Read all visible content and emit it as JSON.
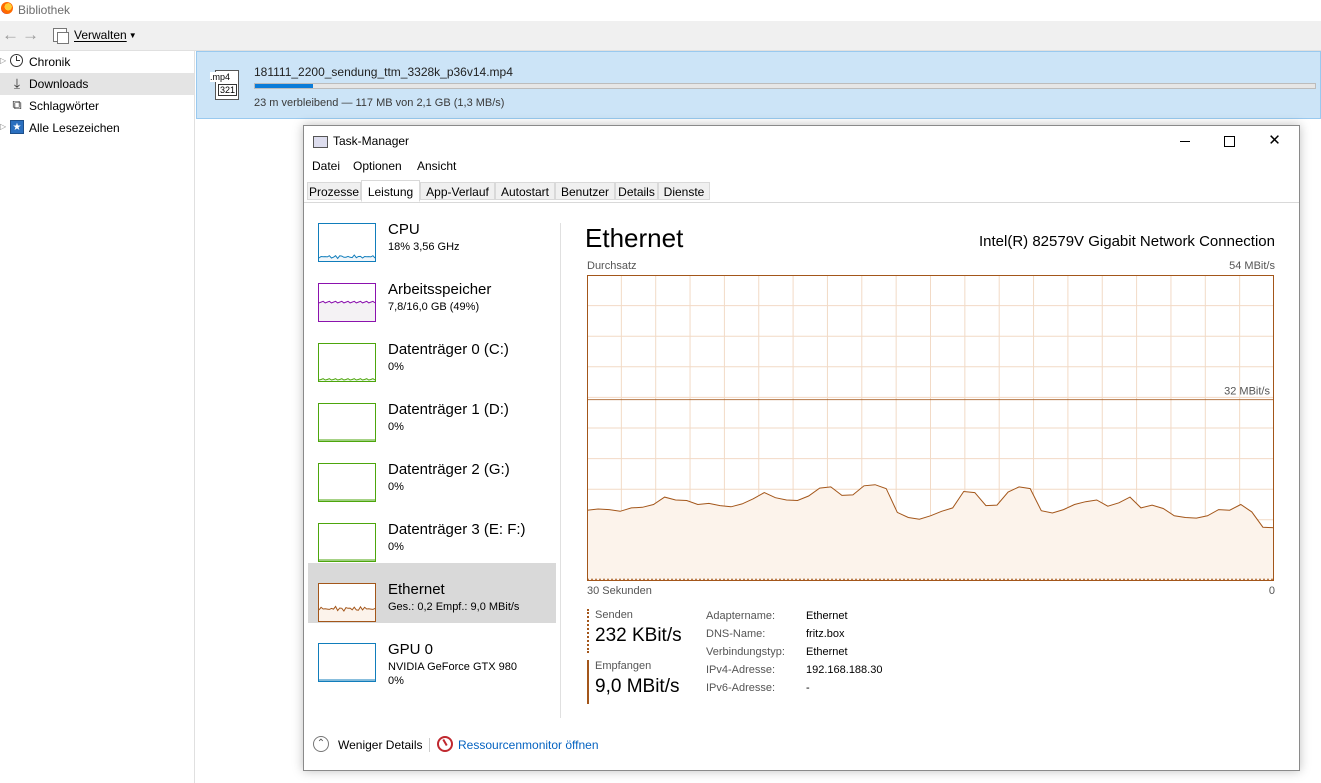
{
  "library": {
    "window_title": "Bibliothek",
    "toolbar": {
      "organize_label": "Verwalten"
    },
    "sidebar": {
      "items": [
        {
          "label": "Chronik",
          "icon": "clock-icon",
          "expandable": true
        },
        {
          "label": "Downloads",
          "icon": "download-arrow-icon",
          "selected": true
        },
        {
          "label": "Schlagwörter",
          "icon": "tag-icon"
        },
        {
          "label": "Alle Lesezeichen",
          "icon": "star-icon",
          "expandable": true
        }
      ]
    },
    "download": {
      "filename": "181111_2200_sendung_ttm_3328k_p36v14.mp4",
      "file_icon_ext": ".mp4",
      "file_icon_badge": "321",
      "status": "23 m verbleibend — 117 MB von 2,1 GB (1,3 MB/s)",
      "progress": 0.055
    }
  },
  "taskmanager": {
    "title": "Task-Manager",
    "menu": [
      "Datei",
      "Optionen",
      "Ansicht"
    ],
    "tabs": [
      "Prozesse",
      "Leistung",
      "App-Verlauf",
      "Autostart",
      "Benutzer",
      "Details",
      "Dienste"
    ],
    "active_tab": "Leistung",
    "perf_items": [
      {
        "name": "CPU",
        "sub": "18% 3,56 GHz",
        "color": "#117dbb",
        "fill": "#f1f6fa"
      },
      {
        "name": "Arbeitsspeicher",
        "sub": "7,8/16,0 GB (49%)",
        "color": "#8b12ae",
        "fill": "#f4f2f4"
      },
      {
        "name": "Datenträger 0 (C:)",
        "sub": "0%",
        "color": "#4da60c",
        "fill": "#eff7ef"
      },
      {
        "name": "Datenträger 1 (D:)",
        "sub": "0%",
        "color": "#4da60c",
        "fill": "#eff7ef"
      },
      {
        "name": "Datenträger 2 (G:)",
        "sub": "0%",
        "color": "#4da60c",
        "fill": "#eff7ef"
      },
      {
        "name": "Datenträger 3 (E: F:)",
        "sub": "0%",
        "color": "#4da60c",
        "fill": "#eff7ef"
      },
      {
        "name": "Ethernet",
        "sub": "Ges.: 0,2 Empf.: 9,0 MBit/s",
        "color": "#a3561a",
        "fill": "#fcf3eb",
        "selected": true
      },
      {
        "name": "GPU 0",
        "sub": "NVIDIA GeForce GTX 980",
        "sub2": "0%",
        "color": "#117dbb",
        "fill": "#f1f6fa"
      }
    ],
    "detail": {
      "title": "Ethernet",
      "adapter": "Intel(R) 82579V Gigabit Network Connection",
      "throughput_label": "Durchsatz",
      "max_label": "54 MBit/s",
      "mid_label": "32 MBit/s",
      "time_label": "30 Sekunden",
      "zero_label": "0",
      "send_label": "Senden",
      "send_value": "232 KBit/s",
      "recv_label": "Empfangen",
      "recv_value": "9,0 MBit/s",
      "properties": [
        {
          "key": "Adaptername:",
          "value": "Ethernet"
        },
        {
          "key": "DNS-Name:",
          "value": "fritz.box"
        },
        {
          "key": "Verbindungstyp:",
          "value": "Ethernet"
        },
        {
          "key": "IPv4-Adresse:",
          "value": "192.168.188.30"
        },
        {
          "key": "IPv6-Adresse:",
          "value": "-"
        }
      ]
    },
    "footer": {
      "fewer_details": "Weniger Details",
      "resource_monitor": "Ressourcenmonitor öffnen"
    },
    "chart_data": {
      "type": "area",
      "y_unit": "MBit/s",
      "ylim": [
        0,
        54
      ],
      "x_span_seconds": 30,
      "reference_lines": [
        32
      ],
      "series": [
        {
          "name": "Empfangen",
          "values": [
            12.5,
            12.7,
            12.6,
            12.3,
            12.9,
            13.0,
            13.5,
            14.8,
            14.3,
            14.2,
            13.5,
            13.7,
            13.3,
            13.1,
            13.6,
            14.5,
            15.6,
            14.7,
            14.3,
            14.2,
            15.0,
            16.4,
            16.6,
            15.1,
            15.2,
            16.8,
            17.0,
            16.3,
            12.1,
            11.2,
            10.9,
            11.5,
            12.3,
            12.9,
            15.8,
            15.6,
            13.3,
            13.4,
            15.7,
            16.6,
            16.3,
            12.4,
            12.0,
            12.6,
            13.5,
            14.0,
            14.3,
            13.2,
            13.8,
            14.8,
            12.9,
            13.4,
            12.8,
            11.5,
            11.2,
            11.1,
            11.5,
            12.6,
            12.5,
            13.5,
            12.2,
            9.5,
            9.4
          ]
        },
        {
          "name": "Senden",
          "values": [
            0.3,
            0.3,
            0.3,
            0.3,
            0.3,
            0.3,
            0.3,
            0.3,
            0.3,
            0.3,
            0.3,
            0.3,
            0.3,
            0.3,
            0.3,
            0.3,
            0.3,
            0.3,
            0.3,
            0.3,
            0.3,
            0.3,
            0.3,
            0.3,
            0.3,
            0.3,
            0.3,
            0.3,
            0.3,
            0.3,
            0.3,
            0.3,
            0.3,
            0.3,
            0.3,
            0.3,
            0.3,
            0.3,
            0.3,
            0.3,
            0.3,
            0.3,
            0.3,
            0.3,
            0.3,
            0.3,
            0.3,
            0.3,
            0.3,
            0.3,
            0.3,
            0.3,
            0.3,
            0.3,
            0.3,
            0.3,
            0.3,
            0.3,
            0.3,
            0.3,
            0.3,
            0.3,
            0.3
          ]
        }
      ],
      "line_color": "#a3561a",
      "fill_color": "#fcf3eb",
      "grid_color": "#f2dac6",
      "grid": true
    }
  }
}
